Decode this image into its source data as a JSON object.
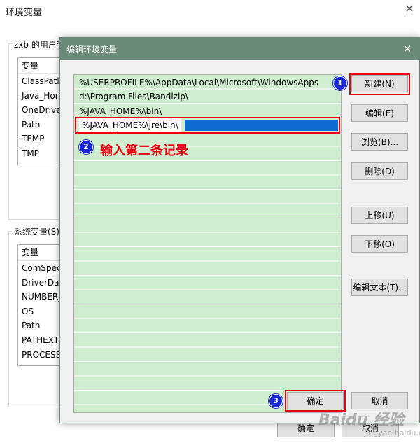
{
  "parent": {
    "title": "环境变量",
    "user_group_label": "zxb 的用户变",
    "system_group_label": "系统变量(S)",
    "user_header": "变量",
    "user_vars": [
      "ClassPath",
      "Java_Hom",
      "OneDrive",
      "Path",
      "TEMP",
      "TMP"
    ],
    "system_header": "变量",
    "system_vars": [
      "ComSpec",
      "DriverDat",
      "NUMBER_",
      "OS",
      "Path",
      "PATHEXT",
      "PROCESS"
    ],
    "ok_label": "确定",
    "cancel_label": "取消"
  },
  "dialog": {
    "title": "编辑环境变量",
    "paths": [
      "%USERPROFILE%\\AppData\\Local\\Microsoft\\WindowsApps",
      "d:\\Program Files\\Bandizip\\",
      "%JAVA_HOME%\\bin\\"
    ],
    "editing_value": "%JAVA_HOME%\\jre\\bin\\",
    "buttons": {
      "new": "新建(N)",
      "edit": "编辑(E)",
      "browse": "浏览(B)...",
      "delete": "删除(D)",
      "move_up": "上移(U)",
      "move_down": "下移(O)",
      "edit_text": "编辑文本(T)..."
    },
    "ok_label": "确定",
    "cancel_label": "取消"
  },
  "annotations": {
    "step1": "1",
    "step2": "2",
    "step3": "3",
    "step2_text": "输入第二条记录",
    "accent_color": "#e60012",
    "badge_color": "#1727d6"
  },
  "watermark": {
    "brand": "Baidu 经验",
    "sub": "jingyan.baidu.com"
  }
}
